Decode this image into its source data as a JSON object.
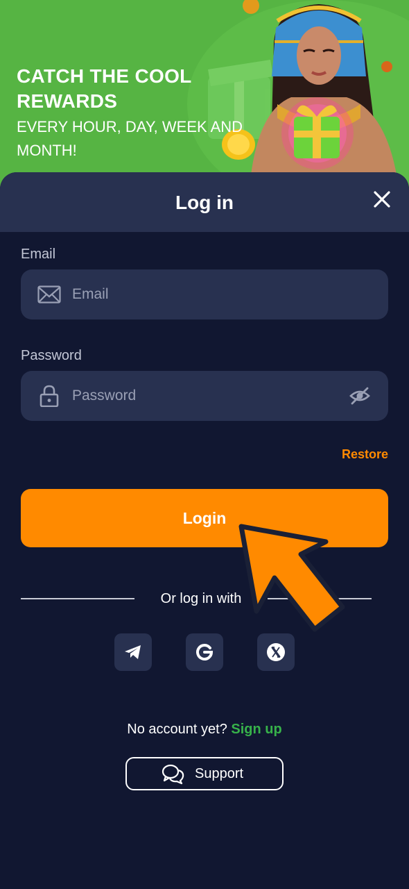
{
  "banner": {
    "title": "CATCH THE COOL REWARDS",
    "subtitle": "EVERY HOUR, DAY, WEEK AND MONTH!",
    "background_color": "#56b443"
  },
  "modal": {
    "title": "Log in",
    "close_icon": "close-icon"
  },
  "email": {
    "label": "Email",
    "placeholder": "Email",
    "value": "",
    "icon": "envelope-icon"
  },
  "password": {
    "label": "Password",
    "placeholder": "Password",
    "value": "",
    "icon": "lock-icon",
    "toggle_icon": "eye-off-icon"
  },
  "restore_label": "Restore",
  "login_label": "Login",
  "social": {
    "divider_text": "Or log in with",
    "providers": [
      "telegram-icon",
      "google-icon",
      "x-icon"
    ]
  },
  "signup": {
    "prompt": "No account yet?",
    "link": "Sign up"
  },
  "support_label": "Support",
  "colors": {
    "accent": "#ff8a00",
    "sheet_bg": "#111731",
    "surface": "#283150",
    "signup_green": "#37b24a"
  }
}
